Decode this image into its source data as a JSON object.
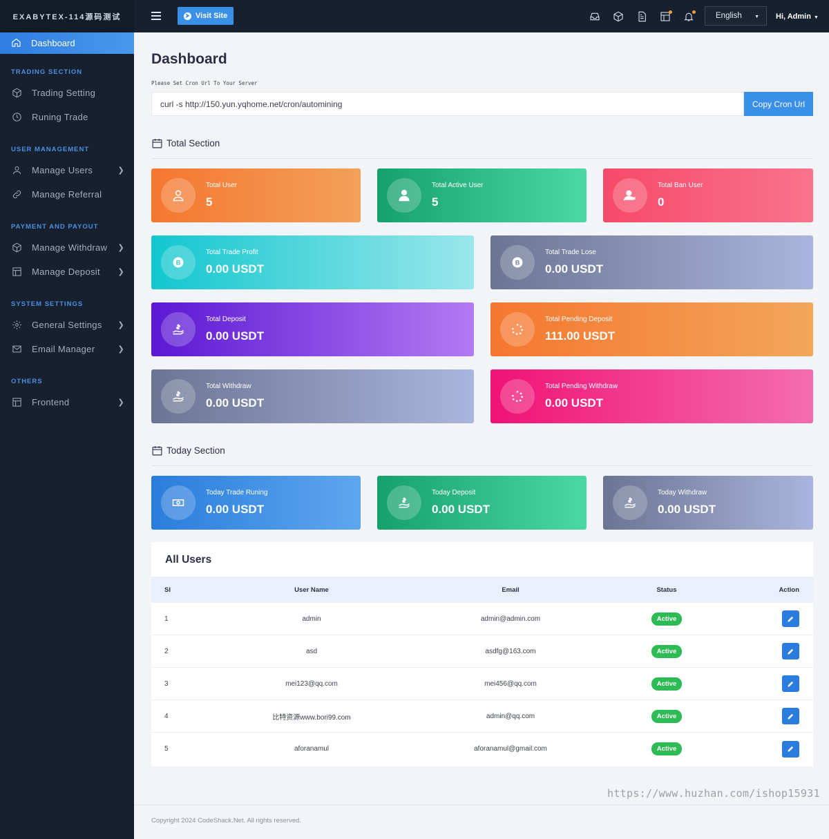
{
  "brand": "EXABYTEX-114源码测试",
  "sidebar": {
    "active": "Dashboard",
    "sections": [
      {
        "title": "TRADING SECTION",
        "items": [
          {
            "label": "Trading Setting",
            "icon": "cube-icon",
            "chevron": false
          },
          {
            "label": "Runing Trade",
            "icon": "clock-icon",
            "chevron": false
          }
        ]
      },
      {
        "title": "USER MANAGEMENT",
        "items": [
          {
            "label": "Manage Users",
            "icon": "user-icon",
            "chevron": true
          },
          {
            "label": "Manage Referral",
            "icon": "link-icon",
            "chevron": false
          }
        ]
      },
      {
        "title": "PAYMENT AND PAYOUT",
        "items": [
          {
            "label": "Manage Withdraw",
            "icon": "cube-icon",
            "chevron": true
          },
          {
            "label": "Manage Deposit",
            "icon": "layout-icon",
            "chevron": true
          }
        ]
      },
      {
        "title": "SYSTEM SETTINGS",
        "items": [
          {
            "label": "General Settings",
            "icon": "gear-icon",
            "chevron": true
          },
          {
            "label": "Email Manager",
            "icon": "mail-icon",
            "chevron": true
          }
        ]
      },
      {
        "title": "OTHERS",
        "items": [
          {
            "label": "Frontend",
            "icon": "layout-icon",
            "chevron": true
          }
        ]
      }
    ]
  },
  "topbar": {
    "visit_site": "Visit Site",
    "language": "English",
    "user": "Hi, Admin"
  },
  "main": {
    "title": "Dashboard",
    "cron_label": "Please Set Cron Url To Your Server",
    "cron_value": "curl -s http://150.yun.yqhome.net/cron/automining",
    "cron_button": "Copy Cron Url",
    "total_section": "Total Section",
    "today_section": "Today Section"
  },
  "total_cards": [
    {
      "label": "Total User",
      "value": "5"
    },
    {
      "label": "Total Active User",
      "value": "5"
    },
    {
      "label": "Total Ban User",
      "value": "0"
    },
    {
      "label": "Total Trade Profit",
      "value": "0.00 USDT"
    },
    {
      "label": "Total Trade Lose",
      "value": "0.00 USDT"
    },
    {
      "label": "Total Deposit",
      "value": "0.00 USDT"
    },
    {
      "label": "Total Pending Deposit",
      "value": "111.00 USDT"
    },
    {
      "label": "Total Withdraw",
      "value": "0.00 USDT"
    },
    {
      "label": "Total Pending Withdraw",
      "value": "0.00 USDT"
    }
  ],
  "today_cards": [
    {
      "label": "Today Trade Runing",
      "value": "0.00 USDT"
    },
    {
      "label": "Today Deposit",
      "value": "0.00 USDT"
    },
    {
      "label": "Today Withdraw",
      "value": "0.00 USDT"
    }
  ],
  "users": {
    "title": "All Users",
    "headers": [
      "Sl",
      "User Name",
      "Email",
      "Status",
      "Action"
    ],
    "rows": [
      {
        "sl": "1",
        "name": "admin",
        "email": "admin@admin.com",
        "status": "Active"
      },
      {
        "sl": "2",
        "name": "asd",
        "email": "asdfg@163.com",
        "status": "Active"
      },
      {
        "sl": "3",
        "name": "mei123@qq.com",
        "email": "mei456@qq.com",
        "status": "Active"
      },
      {
        "sl": "4",
        "name": "比特资源www.bori99.com",
        "email": "admin@qq.com",
        "status": "Active"
      },
      {
        "sl": "5",
        "name": "aforanamul",
        "email": "aforanamul@gmail.com",
        "status": "Active"
      }
    ]
  },
  "watermark": "https://www.huzhan.com/ishop15931",
  "footer": "Copyright 2024 CodeShack.Net. All rights reserved."
}
